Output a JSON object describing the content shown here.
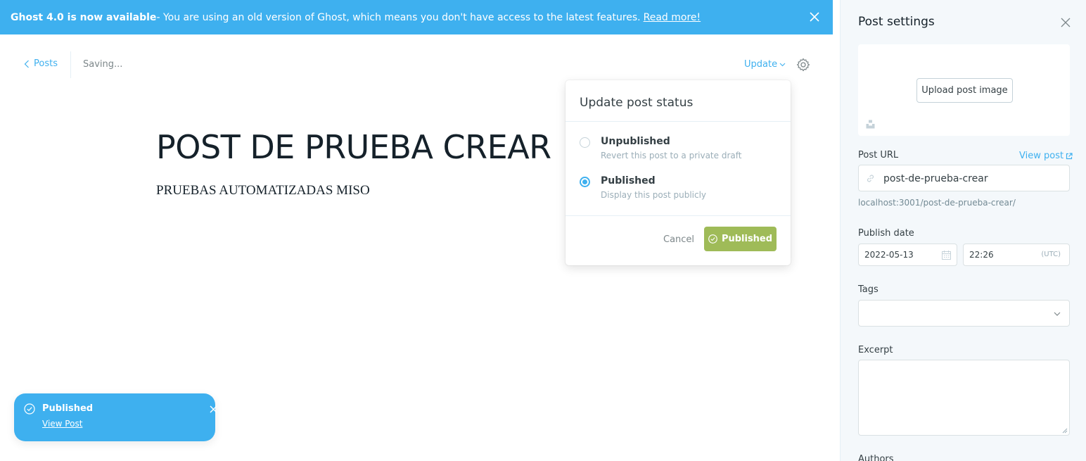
{
  "banner": {
    "bold": "Ghost 4.0 is now available",
    "text": " - You are using an old version of Ghost, which means you don't have access to the latest features.",
    "link": "Read more!"
  },
  "header": {
    "posts_link": "Posts",
    "status": "Saving...",
    "update_label": "Update"
  },
  "post": {
    "title": "POST DE PRUEBA CREAR",
    "body": "PRUEBAS AUTOMATIZADAS MISO"
  },
  "popover": {
    "title": "Update post status",
    "options": [
      {
        "label": "Unpublished",
        "desc": "Revert this post to a private draft",
        "selected": false
      },
      {
        "label": "Published",
        "desc": "Display this post publicly",
        "selected": true
      }
    ],
    "cancel": "Cancel",
    "confirm": "Published"
  },
  "toast": {
    "title": "Published",
    "link": "View Post"
  },
  "sidebar": {
    "title": "Post settings",
    "upload_label": "Upload post image",
    "post_url_label": "Post URL",
    "view_post": "View post",
    "slug": "post-de-prueba-crear",
    "url_hint": "localhost:3001/post-de-prueba-crear/",
    "publish_date_label": "Publish date",
    "date": "2022-05-13",
    "time": "22:26",
    "timezone": "(UTC)",
    "tags_label": "Tags",
    "excerpt_label": "Excerpt",
    "authors_label": "Authors"
  },
  "colors": {
    "accent": "#3eb0ef",
    "publish_green": "#9fbb58"
  }
}
